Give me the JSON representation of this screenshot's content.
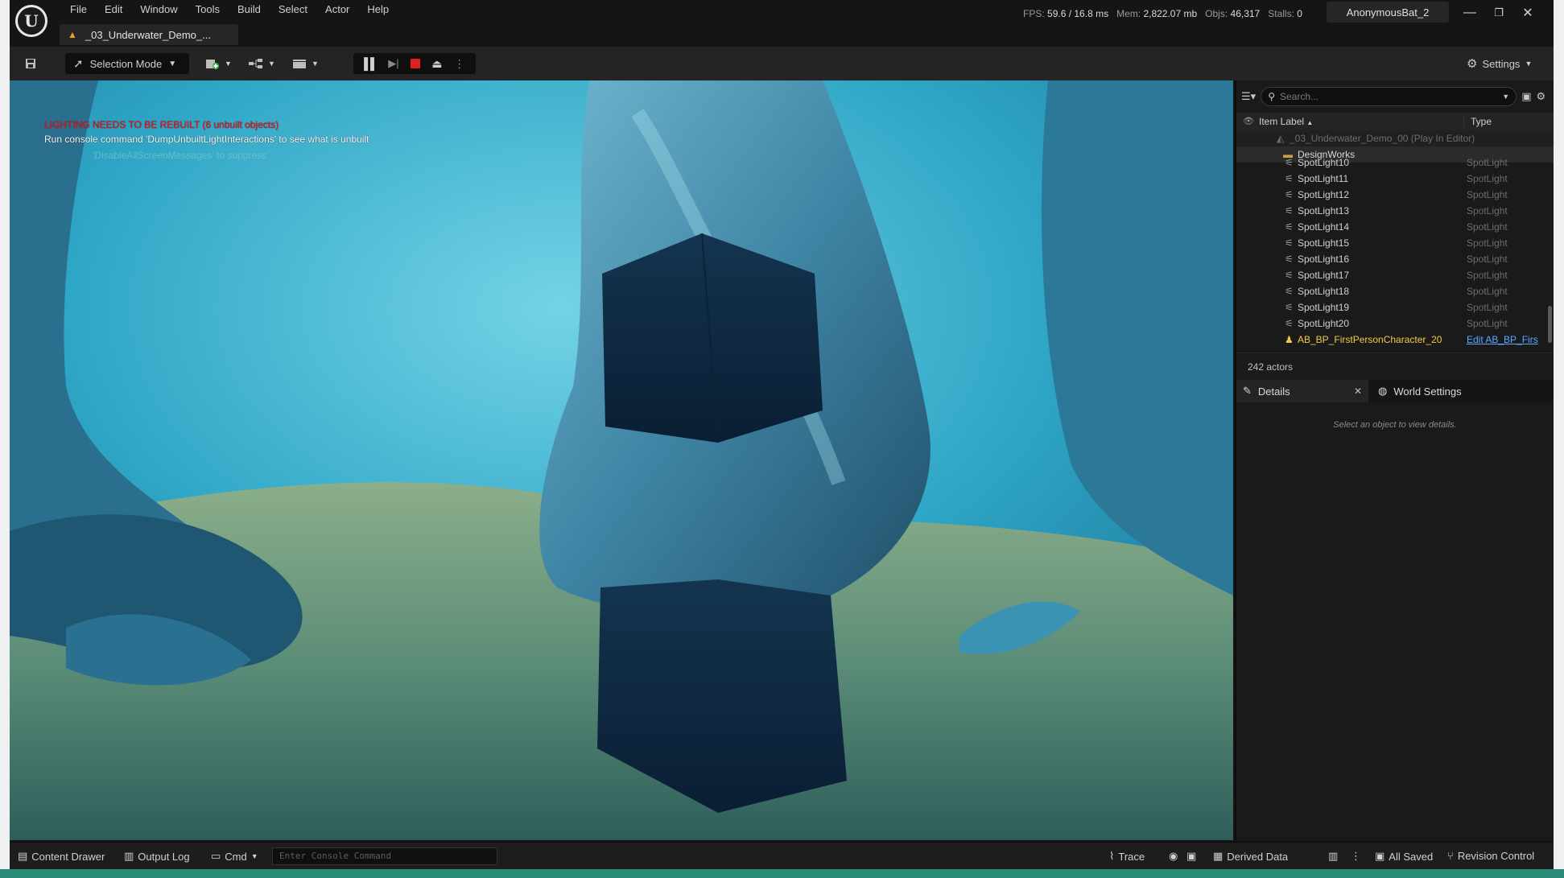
{
  "menu": [
    "File",
    "Edit",
    "Window",
    "Tools",
    "Build",
    "Select",
    "Actor",
    "Help"
  ],
  "document_tab": "_03_Underwater_Demo_...",
  "stats": {
    "fps_label": "FPS:",
    "fps": "59.6",
    "ms": "/ 16.8 ms",
    "mem_label": "Mem:",
    "mem": "2,822.07 mb",
    "objs_label": "Objs:",
    "objs": "46,317",
    "stalls_label": "Stalls:",
    "stalls": "0"
  },
  "user": "AnonymousBat_2",
  "toolbar": {
    "selection_mode": "Selection Mode",
    "settings": "Settings"
  },
  "viewport": {
    "msg_red": "LIGHTING NEEDS TO BE REBUILT (6 unbuilt objects)",
    "msg_white": "Run console command 'DumpUnbuiltLightInteractions' to see what is unbuilt",
    "msg_dim": "'DisableAllScreenMessages' to suppress"
  },
  "outliner": {
    "search_placeholder": "Search...",
    "col_label": "Item Label",
    "col_type": "Type",
    "root": "_03_Underwater_Demo_00 (Play In Editor)",
    "folder": "DesignWorks",
    "rows": [
      {
        "label": "SpotLight10",
        "type": "SpotLight"
      },
      {
        "label": "SpotLight11",
        "type": "SpotLight"
      },
      {
        "label": "SpotLight12",
        "type": "SpotLight"
      },
      {
        "label": "SpotLight13",
        "type": "SpotLight"
      },
      {
        "label": "SpotLight14",
        "type": "SpotLight"
      },
      {
        "label": "SpotLight15",
        "type": "SpotLight"
      },
      {
        "label": "SpotLight16",
        "type": "SpotLight"
      },
      {
        "label": "SpotLight17",
        "type": "SpotLight"
      },
      {
        "label": "SpotLight18",
        "type": "SpotLight"
      },
      {
        "label": "SpotLight19",
        "type": "SpotLight"
      },
      {
        "label": "SpotLight20",
        "type": "SpotLight"
      }
    ],
    "character": {
      "label": "AB_BP_FirstPersonCharacter_20",
      "type": "Edit AB_BP_Firs"
    },
    "count": "242 actors"
  },
  "details": {
    "tab_details": "Details",
    "tab_world": "World Settings",
    "empty": "Select an object to view details."
  },
  "statusbar": {
    "content_drawer": "Content Drawer",
    "output_log": "Output Log",
    "cmd": "Cmd",
    "console_placeholder": "Enter Console Command",
    "trace": "Trace",
    "derived_data": "Derived Data",
    "all_saved": "All Saved",
    "revision_control": "Revision Control"
  },
  "colors": {
    "warning_red": "#e8141a",
    "accent_blue": "#5aa8ff",
    "character_yellow": "#f2c94c"
  }
}
